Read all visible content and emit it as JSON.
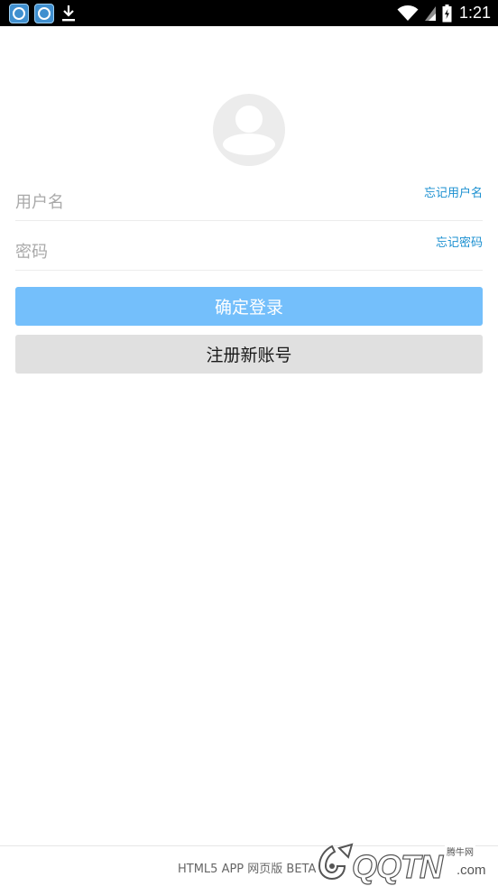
{
  "status_bar": {
    "time": "1:21",
    "icons": [
      "app-icon",
      "app-icon",
      "download-icon",
      "wifi-icon",
      "signal-icon",
      "battery-icon"
    ]
  },
  "login_form": {
    "username_placeholder": "用户名",
    "forgot_username": "忘记用户名",
    "password_placeholder": "密码",
    "forgot_password": "忘记密码",
    "login_button": "确定登录",
    "register_button": "注册新账号"
  },
  "footer": {
    "text": "HTML5 APP 网页版 BETA"
  },
  "watermark": {
    "small_text": "腾牛网",
    "main_text": "QQTN",
    "suffix": ".com"
  },
  "colors": {
    "accent": "#74bffb",
    "link": "#1a8fd0",
    "secondary_button": "#e0e0e0"
  }
}
